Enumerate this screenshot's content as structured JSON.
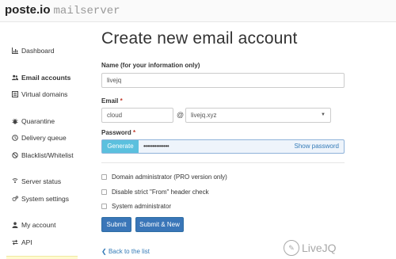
{
  "app": {
    "brand_main": "poste.io",
    "brand_sub": "mailserver"
  },
  "sidebar": {
    "items": [
      {
        "label": "Dashboard",
        "icon": "bar-chart-icon"
      },
      {
        "label": "Email accounts",
        "icon": "users-icon",
        "active": true
      },
      {
        "label": "Virtual domains",
        "icon": "list-icon"
      },
      {
        "label": "Quarantine",
        "icon": "bug-icon"
      },
      {
        "label": "Delivery queue",
        "icon": "clock-icon"
      },
      {
        "label": "Blacklist/Whitelist",
        "icon": "ban-icon"
      },
      {
        "label": "Server status",
        "icon": "signal-icon"
      },
      {
        "label": "System settings",
        "icon": "cogs-icon"
      },
      {
        "label": "My account",
        "icon": "user-icon"
      },
      {
        "label": "API",
        "icon": "exchange-icon"
      }
    ]
  },
  "form": {
    "title": "Create new email account",
    "name_label": "Name (for your information only)",
    "name_value": "livejq",
    "email_label": "Email",
    "required_mark": "*",
    "email_local": "cloud",
    "at_sign": "@",
    "domain_value": "livejq.xyz",
    "password_label": "Password",
    "generate_label": "Generate",
    "password_value": "••••••••••••••",
    "show_password_label": "Show password",
    "checkboxes": [
      {
        "label": "Domain administrator (PRO version only)",
        "checked": false
      },
      {
        "label": "Disable strict \"From\" header check",
        "checked": false
      },
      {
        "label": "System administrator",
        "checked": false
      }
    ],
    "submit_label": "Submit",
    "submit_new_label": "Submit & New",
    "back_label": "Back to the list"
  },
  "watermark": {
    "text": "LiveJQ"
  },
  "colors": {
    "primary": "#3a76b8",
    "info": "#5bc0de",
    "link": "#337ab7"
  }
}
